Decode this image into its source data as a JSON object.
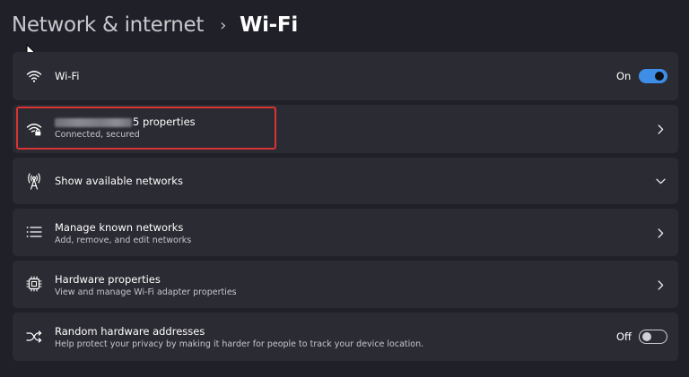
{
  "breadcrumb": {
    "parent": "Network & internet",
    "separator": "›",
    "current": "Wi-Fi"
  },
  "wifi_toggle_row": {
    "icon": "wifi-icon",
    "label": "Wi-Fi",
    "state_label": "On",
    "state": true
  },
  "network_properties_row": {
    "icon": "wifi-secured-icon",
    "title_suffix": "5 properties",
    "subtitle": "Connected, secured",
    "highlighted": true
  },
  "show_networks_row": {
    "icon": "antenna-icon",
    "label": "Show available networks"
  },
  "known_networks_row": {
    "icon": "list-icon",
    "title": "Manage known networks",
    "subtitle": "Add, remove, and edit networks"
  },
  "hardware_row": {
    "icon": "chip-icon",
    "title": "Hardware properties",
    "subtitle": "View and manage Wi-Fi adapter properties"
  },
  "random_addresses_row": {
    "icon": "shuffle-icon",
    "title": "Random hardware addresses",
    "subtitle": "Help protect your privacy by making it harder for people to track your device location.",
    "state_label": "Off",
    "state": false
  },
  "colors": {
    "background": "#202028",
    "card": "#2b2b33",
    "accent": "#3e8ee8",
    "highlight": "#d93434"
  }
}
